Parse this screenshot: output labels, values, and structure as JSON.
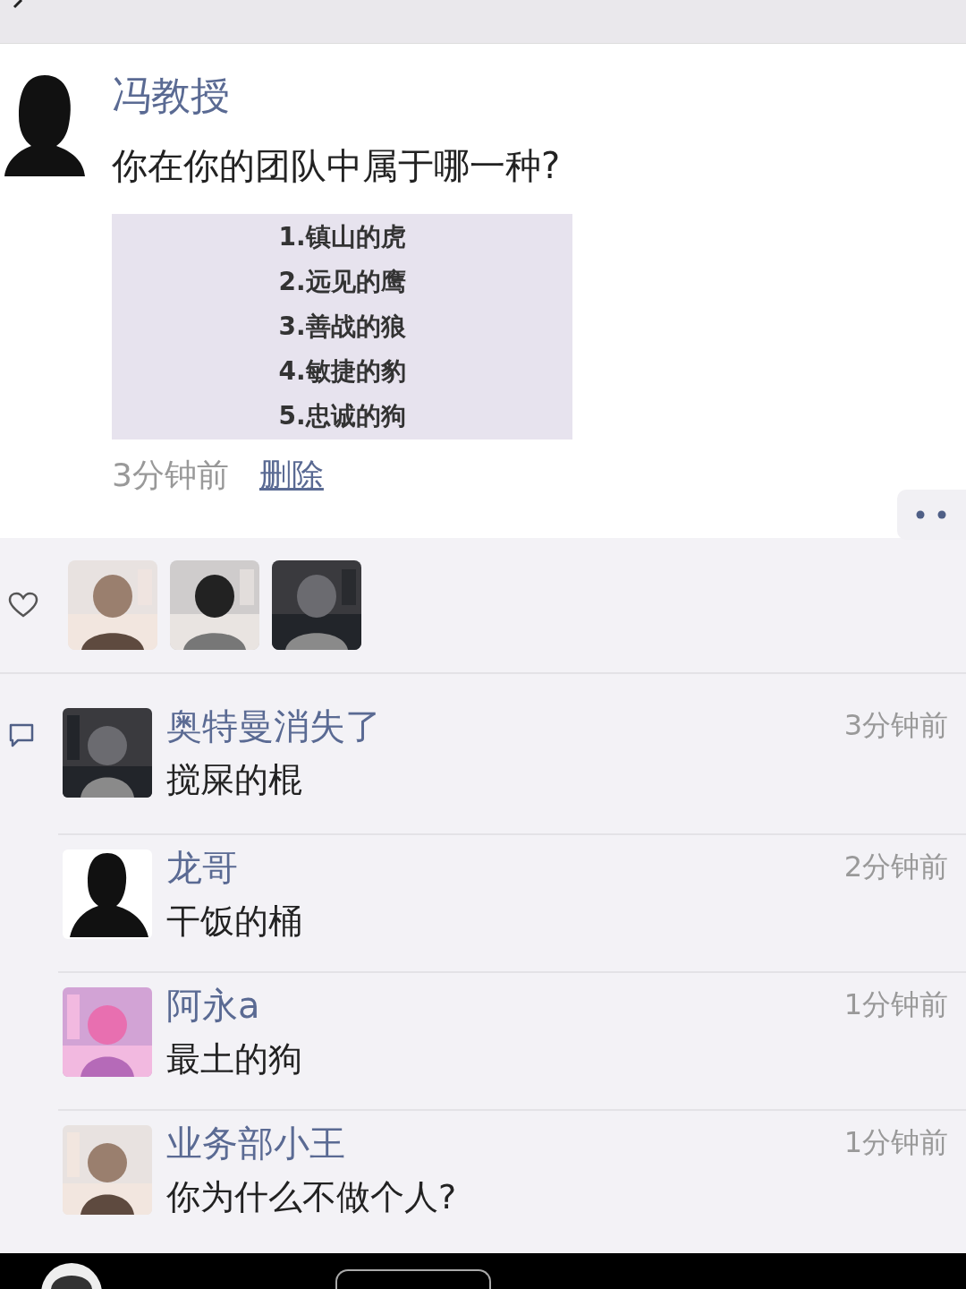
{
  "post": {
    "author": "冯教授",
    "text": "你在你的团队中属于哪一种?",
    "image_lines": [
      "1.镇山的虎",
      "2.远见的鹰",
      "3.善战的狼",
      "4.敏捷的豹",
      "5.忠诚的狗"
    ],
    "time": "3分钟前",
    "delete_link": "删除"
  },
  "comments": [
    {
      "name": "奥特曼消失了",
      "text": "搅屎的棍",
      "time": "3分钟前"
    },
    {
      "name": "龙哥",
      "text": "干饭的桶",
      "time": "2分钟前",
      "avatar": {
        "kind": "silhouette"
      }
    },
    {
      "name": "阿永a",
      "text": "最土的狗",
      "time": "1分钟前"
    },
    {
      "name": "业务部小王",
      "text": "你为什么不做个人?",
      "time": "1分钟前"
    }
  ]
}
